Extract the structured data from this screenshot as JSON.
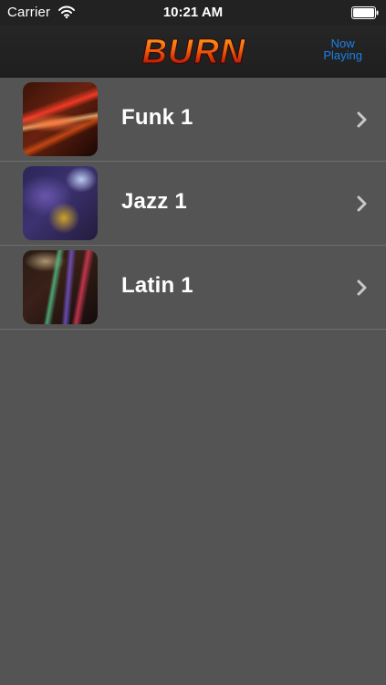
{
  "status_bar": {
    "carrier": "Carrier",
    "time": "10:21 AM",
    "icons": [
      "wifi-icon",
      "battery-icon"
    ]
  },
  "nav_bar": {
    "logo_text": "BURN",
    "now_playing_line1": "Now",
    "now_playing_line2": "Playing",
    "accent_color": "#1a82e8"
  },
  "list": {
    "items": [
      {
        "label": "Funk 1",
        "thumbnail": "funk-thumbnail"
      },
      {
        "label": "Jazz 1",
        "thumbnail": "jazz-thumbnail"
      },
      {
        "label": "Latin 1",
        "thumbnail": "latin-thumbnail"
      }
    ]
  },
  "colors": {
    "background": "#545454",
    "bars": "#222222",
    "text": "#ffffff",
    "separator": "#6e6e6e"
  }
}
